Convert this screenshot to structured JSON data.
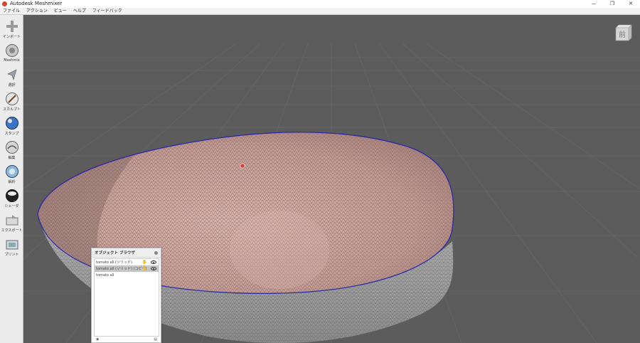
{
  "window": {
    "title": "Autodesk Meshmixer",
    "controls": [
      "—",
      "❐",
      "✕"
    ]
  },
  "menu": [
    "ファイル",
    "アクション",
    "ビュー",
    "ヘルプ",
    "フィードバック"
  ],
  "tools": [
    {
      "label": "インポート",
      "icon": "import-plus-icon"
    },
    {
      "label": "Meshmix",
      "icon": "meshmix-icon"
    },
    {
      "label": "選択",
      "icon": "select-arrow-icon"
    },
    {
      "label": "スカルプト",
      "icon": "sculpt-brush-icon"
    },
    {
      "label": "スタンプ",
      "icon": "stamp-icon"
    },
    {
      "label": "編集",
      "icon": "edit-icon"
    },
    {
      "label": "解析",
      "icon": "analysis-icon"
    },
    {
      "label": "シェーダ",
      "icon": "shader-sphere-icon"
    },
    {
      "label": "エクスポート",
      "icon": "export-icon"
    },
    {
      "label": "プリント",
      "icon": "print-icon"
    }
  ],
  "viewcube": {
    "face_label": "前"
  },
  "object_browser": {
    "title": "オブジェクト ブラウザ",
    "items": [
      {
        "name": "tomato all (ソリッド)",
        "selected": false
      },
      {
        "name": "tomato all (ソリッド) (コピー)",
        "selected": true
      },
      {
        "name": "tomato all",
        "selected": false
      }
    ]
  },
  "colors": {
    "viewport_bg": "#5a5a5a",
    "mesh_inner": "#c9a29a",
    "mesh_outer": "#9a9a9a",
    "rim": "#2a2aa8",
    "marker": "#e0403a"
  }
}
